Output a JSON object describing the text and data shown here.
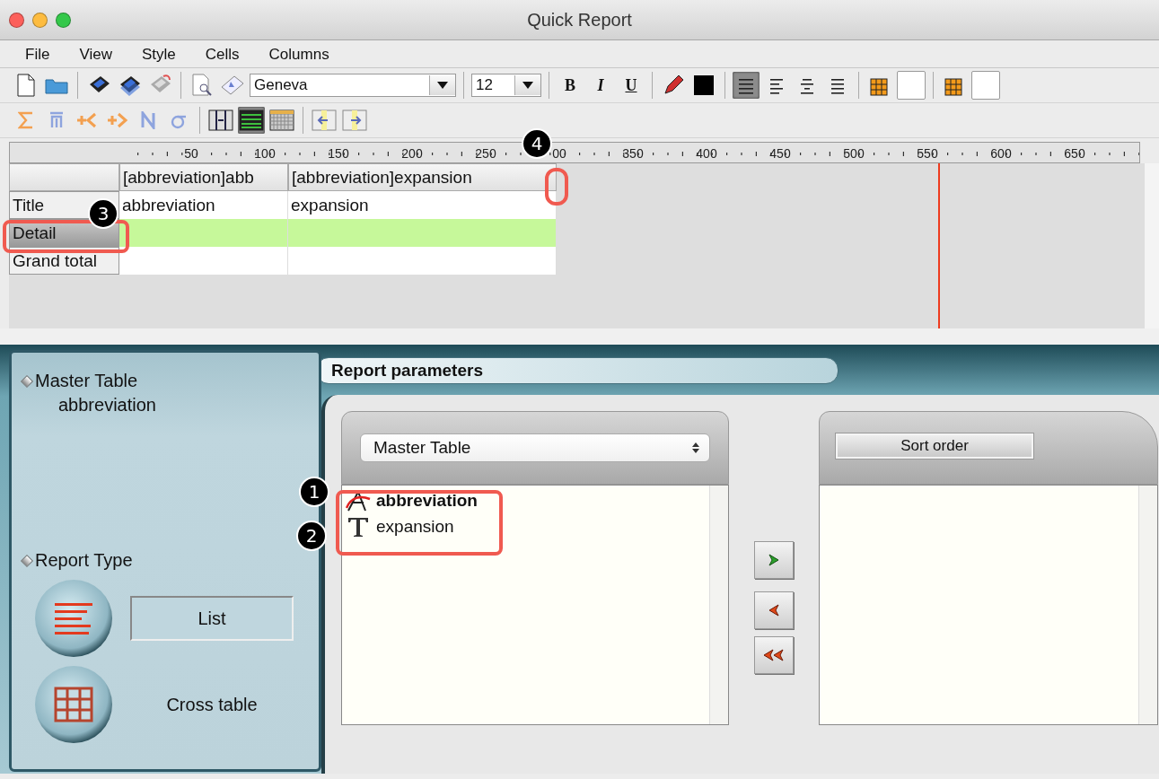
{
  "window": {
    "title": "Quick Report"
  },
  "menu": [
    "File",
    "View",
    "Style",
    "Cells",
    "Columns"
  ],
  "toolbar": {
    "font": "Geneva",
    "size": "12",
    "format_buttons": [
      "B",
      "I",
      "U"
    ],
    "alignment_buttons": [
      {
        "selected": true
      },
      {
        "selected": false
      },
      {
        "selected": false
      },
      {
        "selected": false
      }
    ],
    "view_buttons": [
      {
        "selected": false
      },
      {
        "selected": true
      },
      {
        "selected": false
      }
    ]
  },
  "ruler": {
    "labels": [
      "50",
      "100",
      "150",
      "200",
      "250",
      "00",
      "350",
      "400",
      "450",
      "500",
      "550",
      "600",
      "650"
    ]
  },
  "grid": {
    "columns": [
      "[abbreviation]abb",
      "[abbreviation]expansion"
    ],
    "rows": [
      {
        "label": "Title",
        "cells": [
          "abbreviation",
          "expansion"
        ],
        "selected": false
      },
      {
        "label": "Detail",
        "selected": true
      },
      {
        "label": "Grand total",
        "selected": false
      }
    ]
  },
  "sidebar": {
    "master_table_heading": "Master Table",
    "master_table_value": "abbreviation",
    "report_type_heading": "Report Type",
    "report_types": [
      {
        "label": "List",
        "kind": "list",
        "selected": true
      },
      {
        "label": "Cross table",
        "kind": "cross",
        "selected": false
      }
    ]
  },
  "parameters": {
    "title": "Report parameters",
    "table_select": "Master Table",
    "fields": [
      {
        "name": "abbreviation",
        "kind": "alpha",
        "bold": true
      },
      {
        "name": "expansion",
        "kind": "text",
        "bold": false
      }
    ],
    "sort_title": "Sort order"
  },
  "callouts": [
    {
      "number": "1"
    },
    {
      "number": "2"
    },
    {
      "number": "3"
    },
    {
      "number": "4"
    }
  ]
}
